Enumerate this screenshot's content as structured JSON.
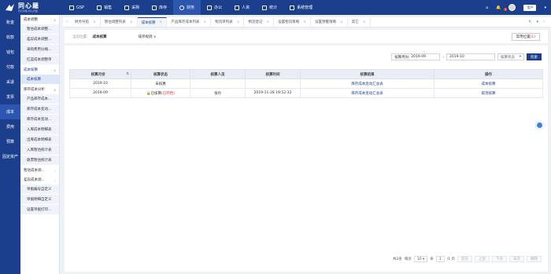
{
  "app": {
    "logo_title": "同心羅",
    "logo_sub": "同行同路·同心同羅"
  },
  "topnav": [
    {
      "label": "GSP",
      "icon": "gsp-icon"
    },
    {
      "label": "销售",
      "icon": "sales-icon"
    },
    {
      "label": "采购",
      "icon": "purchase-icon"
    },
    {
      "label": "库存",
      "icon": "inventory-icon"
    },
    {
      "label": "财务",
      "icon": "finance-icon"
    },
    {
      "label": "办公",
      "icon": "office-icon"
    },
    {
      "label": "人资",
      "icon": "hr-icon"
    },
    {
      "label": "统计",
      "icon": "stats-icon"
    },
    {
      "label": "系统管理",
      "icon": "system-icon"
    }
  ],
  "topbar_right": {
    "notification_count": "1",
    "user_name": "用户"
  },
  "rail": [
    "账金",
    "收款",
    "钱包",
    "付款",
    "采退",
    "发票",
    "成本",
    "费用",
    "预算",
    "固定资产"
  ],
  "subside": {
    "groups": [
      {
        "label": "成本调整",
        "items": [
          "暂估成本调整...",
          "差异成本调整...",
          "采购费用分摊...",
          "红蓝成本调整单"
        ]
      },
      {
        "label": "成本核算",
        "items": [
          "成本核算"
        ]
      },
      {
        "label": "库存成本分析",
        "items": [
          "产品库存成本...",
          "库存成本变动...",
          "库存成本变动...",
          "入库成本明细表",
          "出库成本明细表",
          "入库暂估统计表",
          "收票暂估统计表"
        ]
      },
      {
        "label": "暂估成本调...",
        "items": []
      },
      {
        "label": "差异成本调...",
        "items": [
          "单据编号自定义",
          "单据明细自定义",
          "设置单据打印..."
        ]
      }
    ]
  },
  "tabs": [
    "财务导航",
    "暂估调整列表",
    "成本核算",
    "产品库存成本列表",
    "物流单列表",
    "物流登记",
    "设置物流策略",
    "设置预警策略",
    "其它"
  ],
  "page": {
    "breadcrumb_label": "当前位置:",
    "breadcrumb_current": "成本核算",
    "sort_filter": "排序规则",
    "common_btn": "常用位置",
    "common_count": "(1)"
  },
  "filters": {
    "period_label": "核算月份:",
    "period_start": "2019-09",
    "period_end": "2019-10",
    "status_select": "核算状态",
    "search_btn": "检索"
  },
  "table": {
    "headers": [
      "核算月份",
      "核算状态",
      "核算人员",
      "核算时间",
      "核算结果",
      "操作"
    ],
    "rows": [
      {
        "month": "2019-10",
        "status": "未核算",
        "status_extra": "",
        "person": "",
        "time": "",
        "result": "库存成本变动汇总表",
        "action": "成本核算"
      },
      {
        "month": "2019-09",
        "status": "已核算",
        "status_extra": "(已存档)",
        "person": "张丹",
        "time": "2019-11-28 19:52:32",
        "result": "库存成本变动汇总表",
        "action": "取消核算"
      }
    ]
  },
  "pager": {
    "total": "共2条",
    "per_page_label": "每页",
    "per_page": "10",
    "per_page_unit": "条",
    "current": "1",
    "of_pages": "/1 页",
    "first": "首页",
    "prev": "上页",
    "next": "下页",
    "last": "末页",
    "jump": "跳转"
  }
}
